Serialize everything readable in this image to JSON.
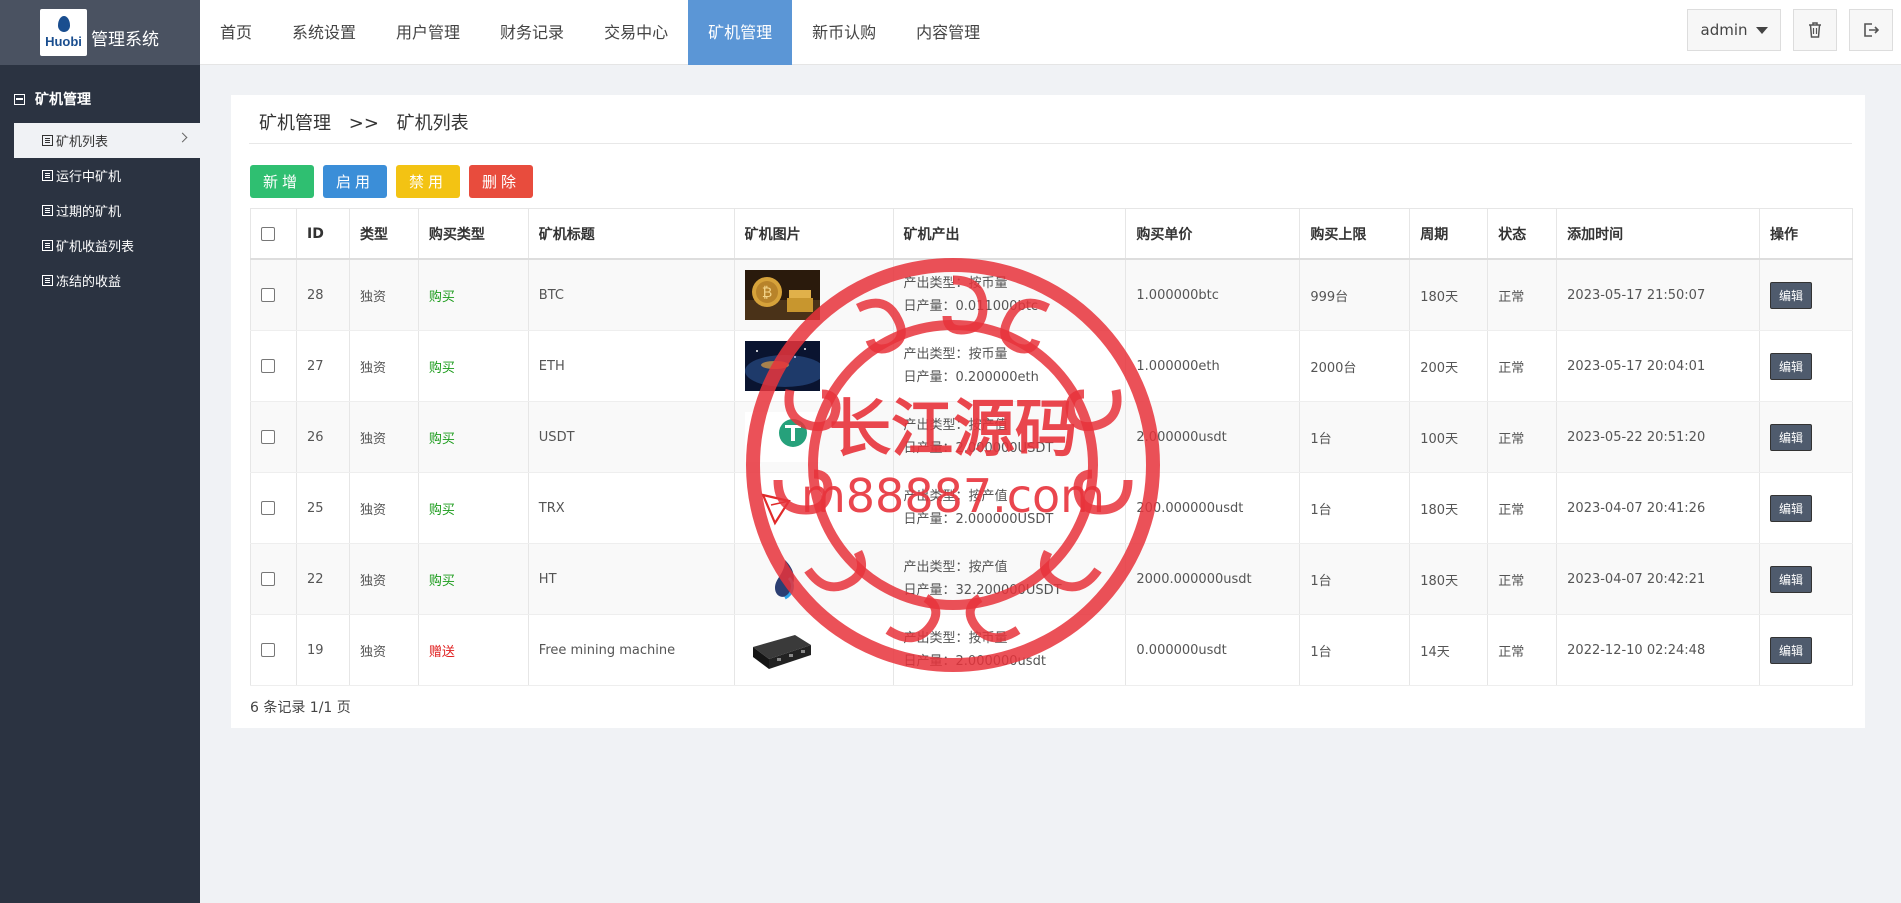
{
  "sidebar": {
    "logo_word": "Huobi",
    "logo_title": "管理系统",
    "section_title": "矿机管理",
    "items": [
      {
        "label": "矿机列表"
      },
      {
        "label": "运行中矿机"
      },
      {
        "label": "过期的矿机"
      },
      {
        "label": "矿机收益列表"
      },
      {
        "label": "冻结的收益"
      }
    ]
  },
  "topnav": {
    "items": [
      "首页",
      "系统设置",
      "用户管理",
      "财务记录",
      "交易中心",
      "矿机管理",
      "新币认购",
      "内容管理"
    ],
    "active": "矿机管理",
    "user": "admin",
    "trash_icon": "trash-icon",
    "logout_icon": "logout-icon"
  },
  "breadcrumb": {
    "parent": "矿机管理",
    "sep": ">>",
    "current": "矿机列表"
  },
  "actions": {
    "add": "新增",
    "enable": "启用",
    "disable": "禁用",
    "delete": "删除"
  },
  "table": {
    "headers": [
      "ID",
      "类型",
      "购买类型",
      "矿机标题",
      "矿机图片",
      "矿机产出",
      "购买单价",
      "购买上限",
      "周期",
      "状态",
      "添加时间",
      "操作"
    ],
    "edit_label": "编辑",
    "rows": [
      {
        "id": "28",
        "type": "独资",
        "buy_type": "购买",
        "title": "BTC",
        "image": "btc-coin-image",
        "out_type": "产出类型：按币量",
        "out_daily": "日产量：0.011000btc",
        "price": "1.000000btc",
        "limit": "999台",
        "cycle": "180天",
        "status": "正常",
        "time": "2023-05-17 21:50:07"
      },
      {
        "id": "27",
        "type": "独资",
        "buy_type": "购买",
        "title": "ETH",
        "image": "eth-space-image",
        "out_type": "产出类型：按币量",
        "out_daily": "日产量：0.200000eth",
        "price": "1.000000eth",
        "limit": "2000台",
        "cycle": "200天",
        "status": "正常",
        "time": "2023-05-17 20:04:01"
      },
      {
        "id": "26",
        "type": "独资",
        "buy_type": "购买",
        "title": "USDT",
        "image": "usdt-logo-image",
        "out_type": "产出类型：按产值",
        "out_daily": "日产量：2.000000USDT",
        "price": "2.000000usdt",
        "limit": "1台",
        "cycle": "100天",
        "status": "正常",
        "time": "2023-05-22 20:51:20"
      },
      {
        "id": "25",
        "type": "独资",
        "buy_type": "购买",
        "title": "TRX",
        "image": "trx-logo-image",
        "out_type": "产出类型：按产值",
        "out_daily": "日产量：2.000000USDT",
        "price": "200.000000usdt",
        "limit": "1台",
        "cycle": "180天",
        "status": "正常",
        "time": "2023-04-07 20:41:26"
      },
      {
        "id": "22",
        "type": "独资",
        "buy_type": "购买",
        "title": "HT",
        "image": "ht-logo-image",
        "out_type": "产出类型：按产值",
        "out_daily": "日产量：32.200000USDT",
        "price": "2000.000000usdt",
        "limit": "1台",
        "cycle": "180天",
        "status": "正常",
        "time": "2023-04-07 20:42:21"
      },
      {
        "id": "19",
        "type": "独资",
        "buy_type": "赠送",
        "title": "Free mining machine",
        "image": "miner-box-image",
        "out_type": "产出类型：按币量",
        "out_daily": "日产量：2.000000usdt",
        "price": "0.000000usdt",
        "limit": "1台",
        "cycle": "14天",
        "status": "正常",
        "time": "2022-12-10 02:24:48"
      }
    ]
  },
  "footer": {
    "summary": "6 条记录 1/1 页"
  },
  "watermark": {
    "line1": "长江源码",
    "line2": "m88887.com",
    "color": "#e8333b"
  },
  "colors": {
    "accent": "#5b96d6",
    "sidebar": "#2b3341",
    "green_btn": "#2fbf71",
    "red": "#e84c3d"
  }
}
